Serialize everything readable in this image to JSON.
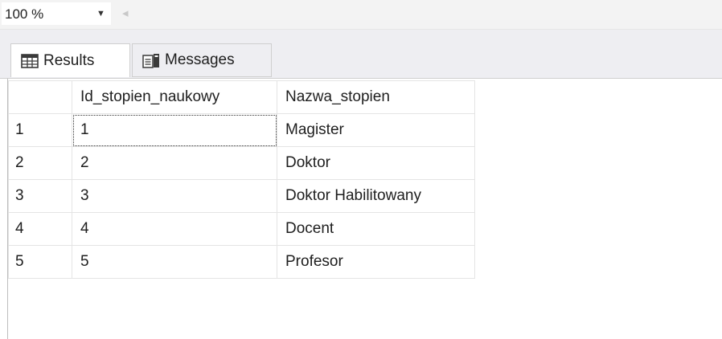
{
  "toolbar": {
    "zoom_value": "100 %",
    "zoom_arrow": "▼",
    "scroll_left_glyph": "◂"
  },
  "tabs": [
    {
      "label": "Results",
      "icon": "grid-icon",
      "active": true
    },
    {
      "label": "Messages",
      "icon": "messages-icon",
      "active": false
    }
  ],
  "grid": {
    "columns": [
      "",
      "Id_stopien_naukowy",
      "Nazwa_stopien"
    ],
    "rows": [
      {
        "rownum": "1",
        "id": "1",
        "name": "Magister"
      },
      {
        "rownum": "2",
        "id": "2",
        "name": "Doktor"
      },
      {
        "rownum": "3",
        "id": "3",
        "name": "Doktor Habilitowany"
      },
      {
        "rownum": "4",
        "id": "4",
        "name": "Docent"
      },
      {
        "rownum": "5",
        "id": "5",
        "name": "Profesor"
      }
    ],
    "selected_cell": {
      "row": 0,
      "column": "Id_stopien_naukowy"
    }
  },
  "colors": {
    "toolbar_bg": "#f3f3f3",
    "tab_strip_bg": "#eeeef2",
    "grid_line": "#e4e4e4"
  }
}
